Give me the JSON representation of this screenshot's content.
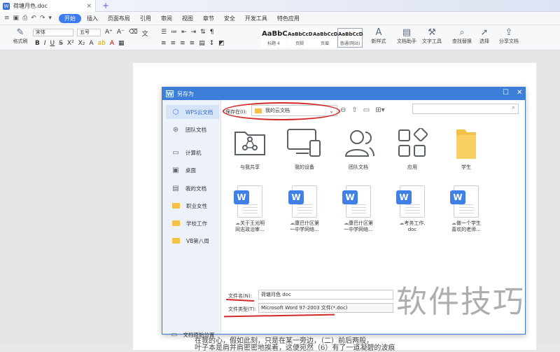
{
  "window": {
    "doc_tab_title": "荷塘月色.doc",
    "doc_tab_icon": "word-doc-icon",
    "new_tab_symbol": "+"
  },
  "menu": {
    "items": [
      "开始",
      "插入",
      "页面布局",
      "引用",
      "审阅",
      "视图",
      "章节",
      "安全",
      "开发工具",
      "特色应用"
    ],
    "active": "开始"
  },
  "ribbon": {
    "format_painter": "格式刷",
    "font_name": "宋体",
    "font_size": "五号",
    "styles": [
      {
        "preview": "AaBbC",
        "label": "标题 4"
      },
      {
        "preview": "AaBbCcDd",
        "label": "页脚"
      },
      {
        "preview": "AaBbCcDd",
        "label": "页眉"
      },
      {
        "preview": "AaBbCcD",
        "label": "普通(网站)"
      }
    ],
    "new_style": "新样式",
    "doc_assistant": "文档助手",
    "text_tools": "文字工具",
    "find_replace": "查找替换",
    "select": "选择",
    "share_doc": "分享文档"
  },
  "document": {
    "bottom_line_1": "在我的心，假如此刻，只是在某一旁边，（二）前后两般，",
    "bottom_line_2": "叶子本是肩并肩密密地挨着，这便宛然（6）有了一道凝碧的波痕"
  },
  "dialog": {
    "title": "另存为",
    "sidebar": [
      {
        "label": "WPS云文档",
        "icon": "cube-icon",
        "selected": true
      },
      {
        "label": "团队文档",
        "icon": "team-icon",
        "selected": false
      },
      {
        "label": "计算机",
        "icon": "computer-icon",
        "selected": false
      },
      {
        "label": "桌面",
        "icon": "desktop-icon",
        "selected": false
      },
      {
        "label": "我的文档",
        "icon": "documents-icon",
        "selected": false
      },
      {
        "label": "职业女性",
        "icon": "folder-icon",
        "selected": false
      },
      {
        "label": "学校工作",
        "icon": "folder-icon",
        "selected": false
      },
      {
        "label": "VB第八周",
        "icon": "folder-icon",
        "selected": false
      }
    ],
    "save_in_label": "保存在(I):",
    "save_in_value": "我的云文档",
    "grid_row1": [
      {
        "label": "与我共享",
        "icon": "share-folder-icon"
      },
      {
        "label": "我的设备",
        "icon": "devices-icon"
      },
      {
        "label": "团队文档",
        "icon": "team-icon"
      },
      {
        "label": "应用",
        "icon": "apps-icon"
      },
      {
        "label": "学生",
        "icon": "folder-icon"
      }
    ],
    "grid_row2": [
      {
        "line1": "关于王光明",
        "line2": "同志政治审..."
      },
      {
        "line1": "康巴什区第",
        "line2": "一中学网络..."
      },
      {
        "line1": "康巴什区第",
        "line2": "一中学网络..."
      },
      {
        "line1": "考务工作.",
        "line2": "doc"
      },
      {
        "line1": "做一个学生",
        "line2": "喜欢的老师..."
      }
    ],
    "filename_label": "文件名(N):",
    "filename_value": "荷塘月色 doc",
    "filetype_label": "文件类型(T):",
    "filetype_value": "Microsoft Word 97-2003 文件(*.doc)",
    "original_location": "文档原始位置"
  },
  "watermark": "软件技巧",
  "colors": {
    "accent": "#3c7ed8",
    "annotation": "#d12a2a",
    "folder": "#f5c043"
  }
}
